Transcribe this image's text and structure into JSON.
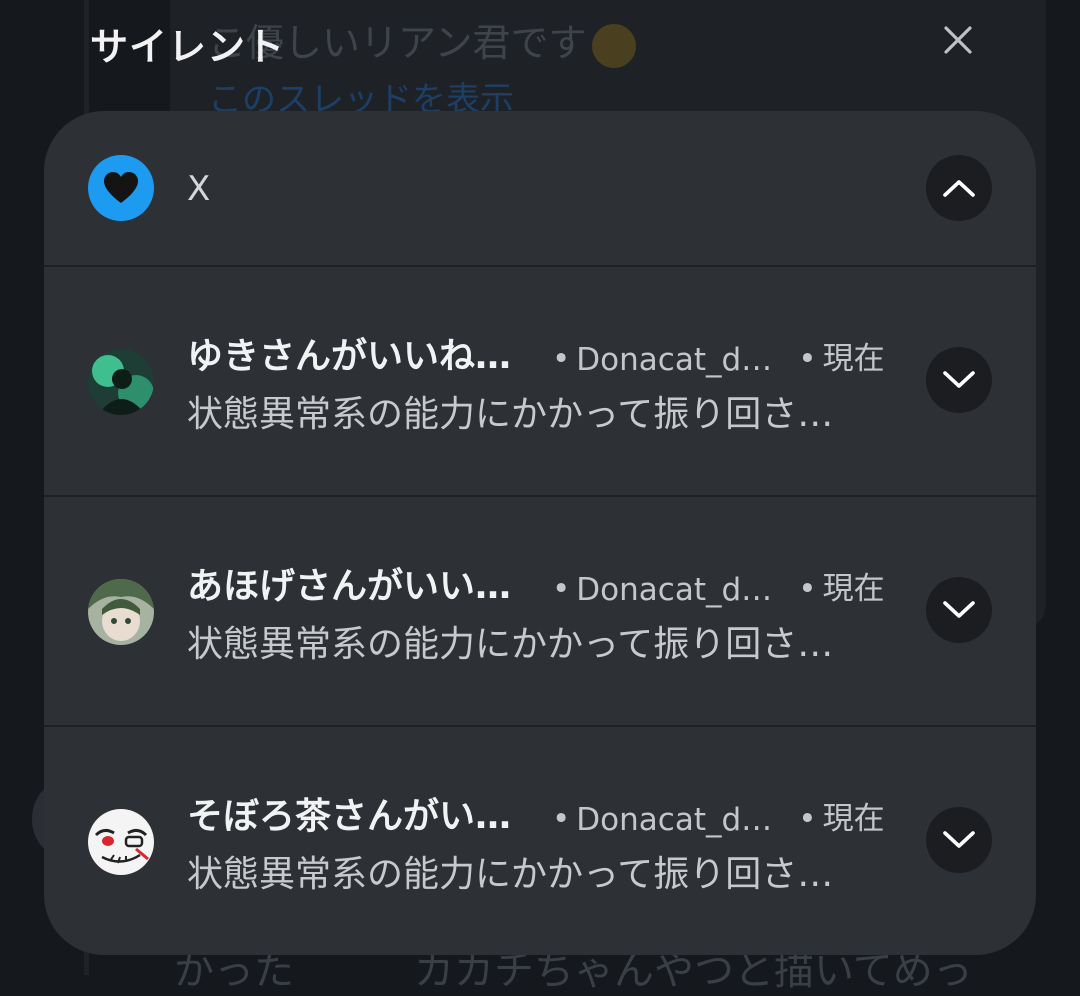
{
  "background": {
    "tweet_text": "こ優しいリアン君です",
    "thread_link": "このスレッドを表示",
    "bottom_text": "かった　　　カカチちゃんやつと描いてめっ"
  },
  "shade": {
    "title": "サイレント",
    "close_icon": "close-icon"
  },
  "group": {
    "app_name": "X",
    "app_icon": "heart-icon",
    "app_icon_color": "#1d9bf0",
    "collapse_icon": "chevron-up-icon"
  },
  "notifications": [
    {
      "title": "ゆきさんがいいね…",
      "account": "Donacat_di…",
      "time": "現在",
      "body": "状態異常系の能力にかかって振り回さ…",
      "avatar_icon": "user-avatar",
      "expand_icon": "chevron-down-icon"
    },
    {
      "title": "あほげさんがいい…",
      "account": "Donacat_di…",
      "time": "現在",
      "body": "状態異常系の能力にかかって振り回さ…",
      "avatar_icon": "user-avatar",
      "expand_icon": "chevron-down-icon"
    },
    {
      "title": "そぼろ茶さんがい…",
      "account": "Donacat_di…",
      "time": "現在",
      "body": "状態異常系の能力にかかって振り回さ…",
      "avatar_icon": "user-avatar",
      "expand_icon": "chevron-down-icon"
    }
  ],
  "meta_separator": "•"
}
